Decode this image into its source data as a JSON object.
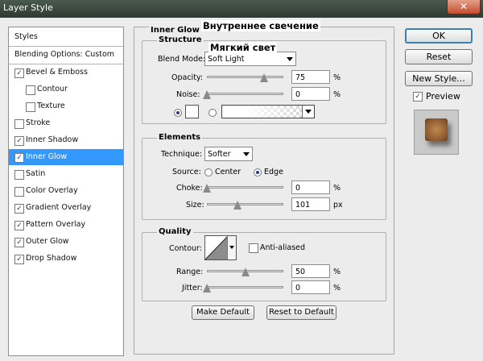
{
  "window": {
    "title": "Layer Style",
    "close": "✕"
  },
  "overlay": {
    "heading": "Внутреннее свечение",
    "sub": "Мягкий свет"
  },
  "sidebar": {
    "styles_label": "Styles",
    "blending": "Blending Options: Custom",
    "items": [
      {
        "label": "Bevel & Emboss",
        "checked": true
      },
      {
        "label": "Contour",
        "checked": false
      },
      {
        "label": "Texture",
        "checked": false
      },
      {
        "label": "Stroke",
        "checked": false
      },
      {
        "label": "Inner Shadow",
        "checked": true
      },
      {
        "label": "Inner Glow",
        "checked": true
      },
      {
        "label": "Satin",
        "checked": false
      },
      {
        "label": "Color Overlay",
        "checked": false
      },
      {
        "label": "Gradient Overlay",
        "checked": true
      },
      {
        "label": "Pattern Overlay",
        "checked": true
      },
      {
        "label": "Outer Glow",
        "checked": true
      },
      {
        "label": "Drop Shadow",
        "checked": true
      }
    ],
    "check": "✓"
  },
  "panel": {
    "title": "Inner Glow",
    "structure": {
      "title": "Structure",
      "blend_mode_label": "Blend Mode:",
      "blend_mode": "Soft Light",
      "opacity_label": "Opacity:",
      "opacity": "75",
      "opacity_level": 0.75,
      "noise_label": "Noise:",
      "noise": "0",
      "noise_level": 0,
      "percent": "%"
    },
    "elements": {
      "title": "Elements",
      "technique_label": "Technique:",
      "technique": "Softer",
      "source_label": "Source:",
      "source_center": "Center",
      "source_edge": "Edge",
      "choke_label": "Choke:",
      "choke": "0",
      "choke_level": 0,
      "size_label": "Size:",
      "size": "101",
      "size_level": 0.4,
      "percent": "%",
      "px": "px"
    },
    "quality": {
      "title": "Quality",
      "contour_label": "Contour:",
      "anti_aliased": "Anti-aliased",
      "range_label": "Range:",
      "range": "50",
      "range_level": 0.5,
      "jitter_label": "Jitter:",
      "jitter": "0",
      "jitter_level": 0,
      "percent": "%"
    },
    "make_default": "Make Default",
    "reset_default": "Reset to Default"
  },
  "buttons": {
    "ok": "OK",
    "reset": "Reset",
    "new_style": "New Style...",
    "preview": "Preview"
  },
  "colors": {
    "selection": "#3399ff",
    "glow_swatch": "#ffffff"
  }
}
